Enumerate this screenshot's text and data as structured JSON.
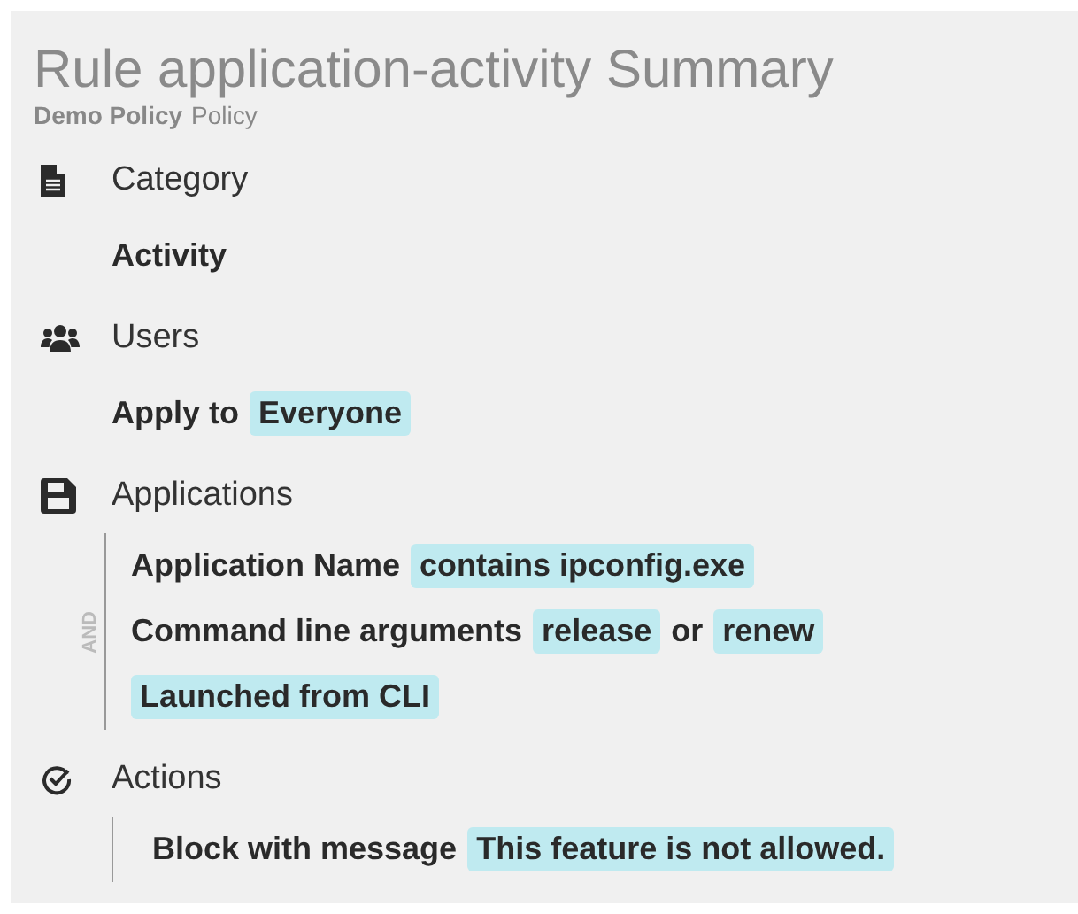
{
  "title": "Rule application-activity Summary",
  "subtitle": [
    {
      "text": "Demo Policy",
      "kind": "strong"
    },
    {
      "text": "Policy",
      "kind": "plain"
    }
  ],
  "sections": [
    {
      "kind": "category",
      "heading": "Category",
      "bordered": false,
      "lines": [
        [
          {
            "text": "Activity",
            "kind": "plain"
          }
        ]
      ]
    },
    {
      "kind": "users",
      "heading": "Users",
      "bordered": false,
      "lines": [
        [
          {
            "text": "Apply to",
            "kind": "plain"
          },
          {
            "text": "Everyone",
            "kind": "value"
          }
        ]
      ]
    },
    {
      "kind": "applications",
      "heading": "Applications",
      "bordered": true,
      "connector": "AND",
      "lines": [
        [
          {
            "text": "Application Name",
            "kind": "plain"
          },
          {
            "text": "contains ipconfig.exe",
            "kind": "value"
          }
        ],
        [
          {
            "text": "Command line arguments",
            "kind": "plain"
          },
          {
            "text": "release",
            "kind": "value"
          },
          {
            "text": "or",
            "kind": "plain"
          },
          {
            "text": "renew",
            "kind": "value"
          }
        ],
        [
          {
            "text": "Launched from CLI",
            "kind": "value"
          }
        ]
      ]
    },
    {
      "kind": "actions",
      "heading": "Actions",
      "bordered": true,
      "lines": [
        [
          {
            "text": "Block with message",
            "kind": "plain"
          },
          {
            "text": "This feature is not allowed.",
            "kind": "value"
          }
        ]
      ]
    }
  ]
}
